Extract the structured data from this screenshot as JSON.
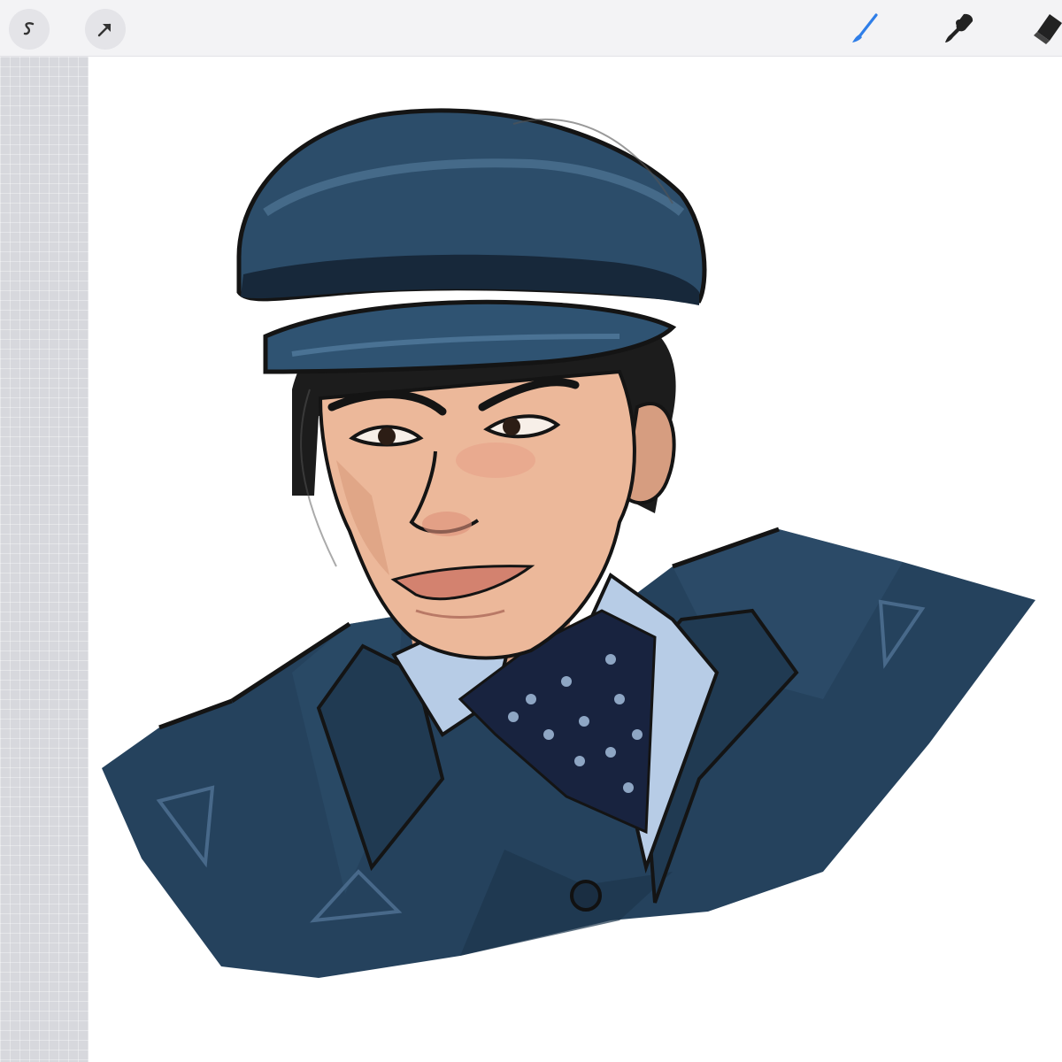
{
  "toolbar": {
    "left_buttons": [
      {
        "name": "selection-tool",
        "icon": "s-selection-icon"
      },
      {
        "name": "transform-tool",
        "icon": "arrow-icon"
      }
    ],
    "right_tools": [
      {
        "name": "brush-tool",
        "icon": "brush-icon",
        "active": true
      },
      {
        "name": "smudge-tool",
        "icon": "smudge-icon",
        "active": false
      },
      {
        "name": "eraser-tool",
        "icon": "eraser-icon",
        "active": false
      }
    ]
  },
  "colors": {
    "active_tool": "#2f7ee8",
    "inactive_tool": "#222222",
    "coat": "#25425d",
    "coat_highlight": "#3e6282",
    "hat": "#2c4d6a",
    "skin": "#ecb89a",
    "shirt": "#b7cce6",
    "scarf": "#18233f",
    "line": "#141414"
  },
  "canvas": {
    "artwork": "portrait-sketch"
  }
}
